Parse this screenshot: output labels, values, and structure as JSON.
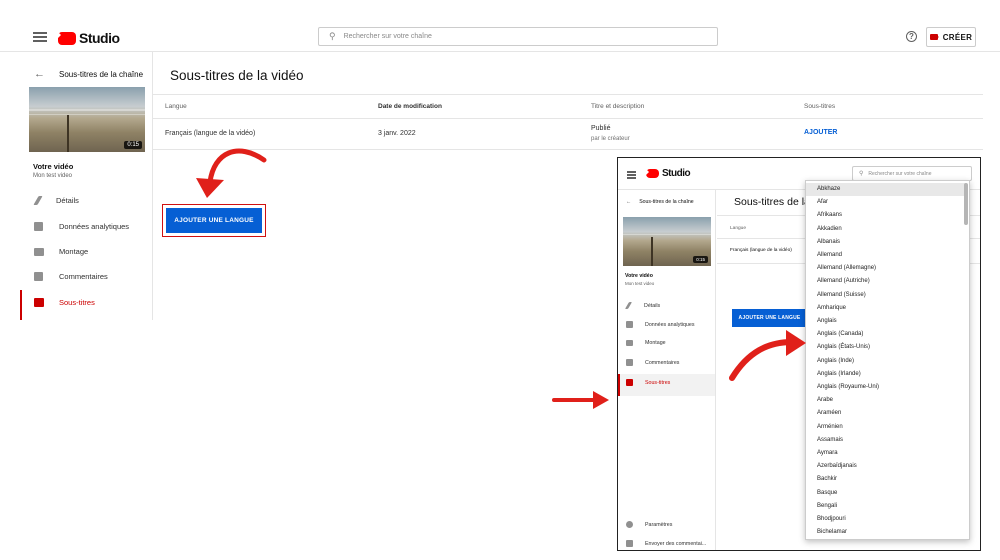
{
  "app": {
    "title": "Studio"
  },
  "search": {
    "placeholder": "Rechercher sur votre chaîne"
  },
  "header": {
    "create_label": "CRÉER",
    "help": "?"
  },
  "sidebar": {
    "back_label": "Sous-titres de la chaîne",
    "video_duration": "0:15",
    "video_heading": "Votre vidéo",
    "video_name": "Mon test video",
    "items": [
      {
        "label": "Détails",
        "icon": "pencil-icon"
      },
      {
        "label": "Données analytiques",
        "icon": "analytics-icon"
      },
      {
        "label": "Montage",
        "icon": "clapper-icon"
      },
      {
        "label": "Commentaires",
        "icon": "comment-icon"
      },
      {
        "label": "Sous-titres",
        "icon": "subtitles-icon",
        "active": true
      }
    ],
    "bottom_items": [
      {
        "label": "Paramètres",
        "icon": "gear-icon"
      },
      {
        "label": "Envoyer des commentai...",
        "icon": "feedback-icon"
      }
    ]
  },
  "main": {
    "title": "Sous-titres de la vidéo",
    "inset_title": "Sous-titres de la",
    "columns": [
      "Langue",
      "Date de modification",
      "Titre et description",
      "Sous-titres"
    ],
    "row": {
      "language": "Français (langue de la vidéo)",
      "date": "3 janv. 2022",
      "status": "Publié",
      "status_sub": "par le créateur",
      "action": "AJOUTER"
    },
    "add_language_button": "AJOUTER UNE LANGUE"
  },
  "dropdown": {
    "options": [
      "Abkhaze",
      "Afar",
      "Afrikaans",
      "Akkadien",
      "Albanais",
      "Allemand",
      "Allemand (Allemagne)",
      "Allemand (Autriche)",
      "Allemand (Suisse)",
      "Amharique",
      "Anglais",
      "Anglais (Canada)",
      "Anglais (États-Unis)",
      "Anglais (Inde)",
      "Anglais (Irlande)",
      "Anglais (Royaume-Uni)",
      "Arabe",
      "Araméen",
      "Arménien",
      "Assamais",
      "Aymara",
      "Azerbaïdjanais",
      "Bachkir",
      "Basque",
      "Bengali",
      "Bhodjpouri",
      "Bichelamar"
    ],
    "selected": "Abkhaze"
  },
  "colors": {
    "accent": "#065fd4",
    "brand": "#ff0000",
    "active": "#cc0000",
    "annotation": "#e0201a"
  }
}
